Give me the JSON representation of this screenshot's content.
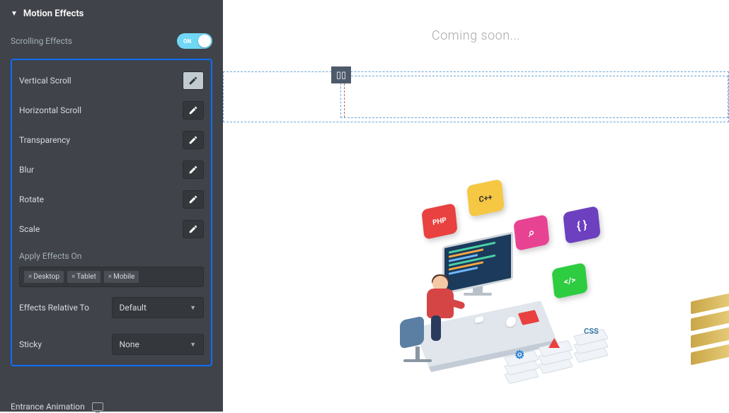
{
  "panel": {
    "title": "Motion Effects",
    "scrolling_label": "Scrolling Effects",
    "switch_on": "ON",
    "effects": {
      "vertical_scroll": "Vertical Scroll",
      "horizontal_scroll": "Horizontal Scroll",
      "transparency": "Transparency",
      "blur": "Blur",
      "rotate": "Rotate",
      "scale": "Scale"
    },
    "apply_effects_label": "Apply Effects On",
    "chips": {
      "desktop": "Desktop",
      "tablet": "Tablet",
      "mobile": "Mobile"
    },
    "effects_relative_label": "Effects Relative To",
    "effects_relative_value": "Default",
    "sticky_label": "Sticky",
    "sticky_value": "None",
    "entrance_label": "Entrance Animation"
  },
  "canvas": {
    "heading": "Coming soon...",
    "cards": {
      "php": "PHP",
      "cpp": "C++",
      "search": "⌕",
      "brace": "{ }",
      "code": "</>"
    },
    "stacks": {
      "gear": "⚙",
      "css": "CSS"
    }
  }
}
